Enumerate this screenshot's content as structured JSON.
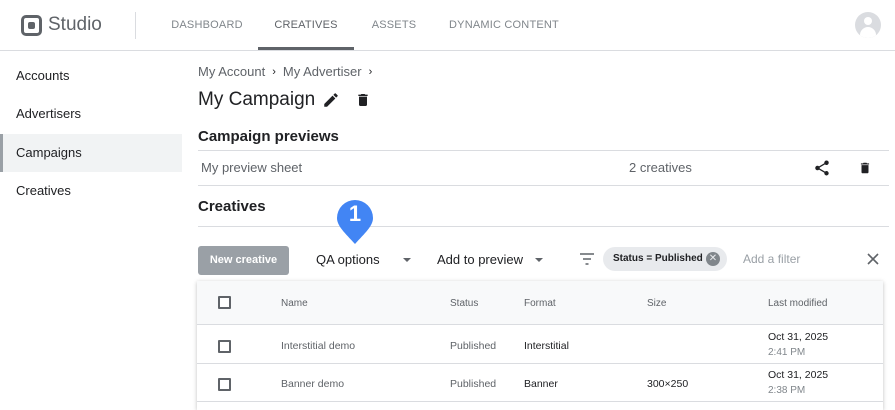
{
  "app": {
    "name": "Studio"
  },
  "nav": {
    "tabs": [
      {
        "label": "DASHBOARD"
      },
      {
        "label": "CREATIVES"
      },
      {
        "label": "ASSETS"
      },
      {
        "label": "DYNAMIC CONTENT"
      }
    ],
    "active": "CREATIVES"
  },
  "sidebar": {
    "items": [
      {
        "label": "Accounts"
      },
      {
        "label": "Advertisers"
      },
      {
        "label": "Campaigns"
      },
      {
        "label": "Creatives"
      }
    ],
    "active": "Campaigns"
  },
  "breadcrumb": [
    "My Account",
    "My Advertiser"
  ],
  "page": {
    "title": "My Campaign"
  },
  "previews": {
    "heading": "Campaign previews",
    "sheet_name": "My preview sheet",
    "count": "2 creatives"
  },
  "creatives": {
    "heading": "Creatives",
    "new_button": "New creative",
    "qa_options": "QA options",
    "add_to_preview": "Add to preview",
    "filter_chip": "Status = Published",
    "filter_placeholder": "Add a filter"
  },
  "callout": {
    "number": "1",
    "color": "#4285f4"
  },
  "table": {
    "headers": [
      "Name",
      "Status",
      "Format",
      "Size",
      "Last modified"
    ],
    "rows": [
      {
        "name": "Interstitial demo",
        "status": "Published",
        "format": "Interstitial",
        "size": "",
        "date": "Oct 31, 2025",
        "time": "2:41 PM"
      },
      {
        "name": "Banner demo",
        "status": "Published",
        "format": "Banner",
        "size": "300×250",
        "date": "Oct 31, 2025",
        "time": "2:38 PM"
      }
    ]
  },
  "icons": [
    "studio-logo-icon",
    "avatar-icon",
    "edit-icon",
    "delete-icon",
    "share-icon",
    "filter-icon",
    "close-icon",
    "chevron-right-icon",
    "caret-down-icon"
  ]
}
